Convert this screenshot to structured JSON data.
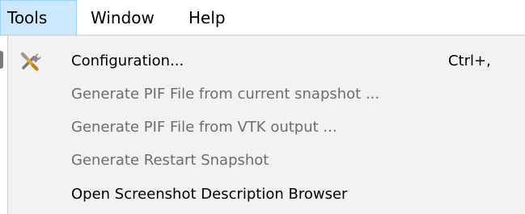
{
  "menubar": {
    "items": [
      {
        "label": "Tools",
        "active": true
      },
      {
        "label": "Window"
      },
      {
        "label": "Help"
      }
    ]
  },
  "dropdown": {
    "items": [
      {
        "label": "Configuration...",
        "shortcut": "Ctrl+,",
        "icon": "tools-icon",
        "enabled": true
      },
      {
        "label": "Generate PIF File from current snapshot ...",
        "enabled": false
      },
      {
        "label": "Generate PIF File from VTK output ...",
        "enabled": false
      },
      {
        "label": "Generate Restart Snapshot",
        "enabled": false
      },
      {
        "label": "Open Screenshot Description Browser",
        "enabled": true
      }
    ]
  },
  "colors": {
    "menubar_active_bg": "#cce8ff",
    "menubar_active_border": "#99d1ff",
    "dropdown_bg": "#f2f2f2",
    "disabled_text": "#6d6d6d",
    "enabled_text": "#000000"
  }
}
